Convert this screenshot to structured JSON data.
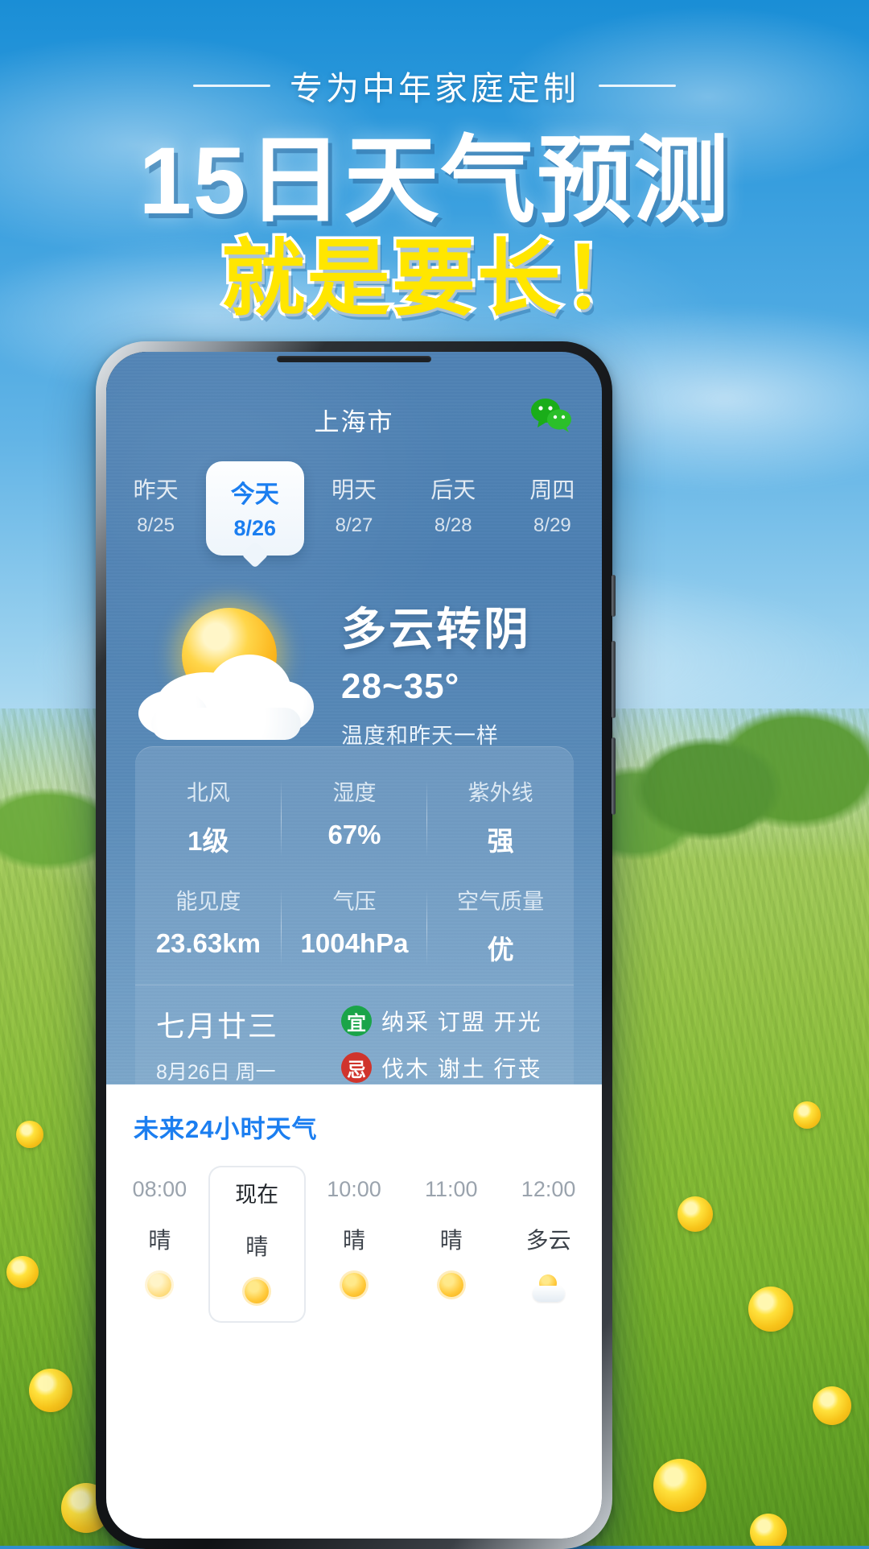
{
  "promo": {
    "kicker": "专为中年家庭定制",
    "headline_1": "15日天气预测",
    "headline_2": "就是要长！"
  },
  "app": {
    "city": "上海市",
    "wechat_icon": "wechat-icon",
    "day_tabs": [
      {
        "name": "昨天",
        "date": "8/25",
        "active": false
      },
      {
        "name": "今天",
        "date": "8/26",
        "active": true
      },
      {
        "name": "明天",
        "date": "8/27",
        "active": false
      },
      {
        "name": "后天",
        "date": "8/28",
        "active": false
      },
      {
        "name": "周四",
        "date": "8/29",
        "active": false
      }
    ],
    "current": {
      "icon": "sun-behind-cloud-icon",
      "condition": "多云转阴",
      "temperature_range": "28~35°",
      "note": "温度和昨天一样"
    },
    "stats": [
      {
        "label": "北风",
        "value": "1级"
      },
      {
        "label": "湿度",
        "value": "67%"
      },
      {
        "label": "紫外线",
        "value": "强"
      },
      {
        "label": "能见度",
        "value": "23.63km"
      },
      {
        "label": "气压",
        "value": "1004hPa"
      },
      {
        "label": "空气质量",
        "value": "优"
      }
    ],
    "almanac": {
      "lunar": "七月廿三",
      "date": "8月26日 周一",
      "good_badge": "宜",
      "good_items": "纳采 订盟 开光",
      "bad_badge": "忌",
      "bad_items": "伐木 谢土 行丧",
      "good_color": "#1aa449",
      "bad_color": "#d0342c"
    },
    "hourly": {
      "title": "未来24小时天气",
      "items": [
        {
          "time": "08:00",
          "cond": "晴",
          "icon": "sun-icon",
          "now": false
        },
        {
          "time": "现在",
          "cond": "晴",
          "icon": "sun-icon",
          "now": true
        },
        {
          "time": "10:00",
          "cond": "晴",
          "icon": "sun-icon",
          "now": false
        },
        {
          "time": "11:00",
          "cond": "晴",
          "icon": "sun-icon",
          "now": false
        },
        {
          "time": "12:00",
          "cond": "多云",
          "icon": "sun-behind-cloud-icon",
          "now": false
        }
      ]
    }
  },
  "colors": {
    "accent_blue": "#1b7ef0",
    "headline_yellow": "#ffe600",
    "app_bg": "#4f82b4"
  }
}
